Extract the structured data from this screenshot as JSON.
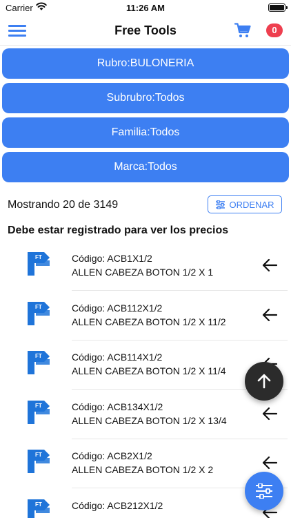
{
  "status_bar": {
    "carrier": "Carrier",
    "time": "11:26 AM"
  },
  "navbar": {
    "title": "Free Tools",
    "cart_count": "0"
  },
  "filters": {
    "rubro": "Rubro:BULONERIA",
    "subrubro": "Subrubro:Todos",
    "familia": "Familia:Todos",
    "marca": "Marca:Todos"
  },
  "results": {
    "showing": "Mostrando 20 de 3149",
    "sort_label": "ORDENAR",
    "notice": "Debe estar registrado para ver los precios"
  },
  "products": [
    {
      "code": "Código: ACB1X1/2",
      "name": "ALLEN CABEZA BOTON 1/2 X 1"
    },
    {
      "code": "Código: ACB112X1/2",
      "name": "ALLEN CABEZA BOTON 1/2 X 11/2"
    },
    {
      "code": "Código: ACB114X1/2",
      "name": "ALLEN CABEZA BOTON 1/2 X 11/4"
    },
    {
      "code": "Código: ACB134X1/2",
      "name": "ALLEN CABEZA BOTON 1/2 X 13/4"
    },
    {
      "code": "Código: ACB2X1/2",
      "name": "ALLEN CABEZA BOTON 1/2 X 2"
    },
    {
      "code": "Código: ACB212X1/2",
      "name": ""
    }
  ],
  "logo_text": "FT",
  "icons": {
    "menu": "hamburger-menu-icon",
    "cart": "shopping-cart-icon",
    "sort": "sliders-icon",
    "row_action": "arrow-left-icon",
    "scroll_top": "arrow-up-icon",
    "filter": "sliders-icon"
  },
  "colors": {
    "accent": "#3d7ff2",
    "badge": "#ee3f4f",
    "fab_dark": "#2b2b2b"
  }
}
